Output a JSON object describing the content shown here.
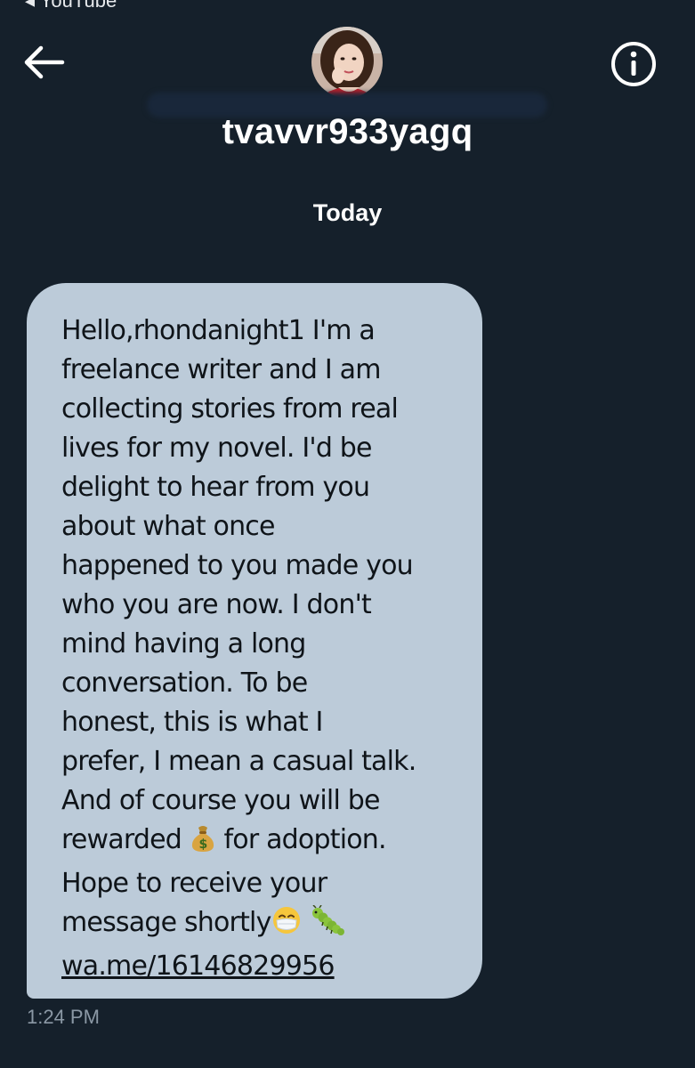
{
  "status_bar": {
    "back_app_label": "◂ YouTube"
  },
  "header": {
    "username": "tvavvr933yagq",
    "back_icon": "arrow-left-icon",
    "info_icon": "info-icon"
  },
  "conversation": {
    "date_separator": "Today",
    "message": {
      "lines": [
        "Hello,rhondanight1 I'm a",
        "freelance writer and I am",
        "collecting stories from real",
        "lives for my novel. I'd be",
        "delight to hear from you",
        "about what once",
        "happened to you made you",
        "who you are now. I don't",
        "mind having a long",
        "conversation. To be",
        "honest, this is what I",
        "prefer, I mean a casual talk.",
        "And of course you will be"
      ],
      "line_reward_before": "rewarded",
      "line_reward_after": "for adoption.",
      "line_hope": "Hope to receive your",
      "line_shortly": "message shortly",
      "link": "wa.me/16146829956",
      "emojis": [
        "money-bag-icon",
        "mask-face-icon",
        "caterpillar-icon"
      ],
      "time": "1:24 PM"
    }
  },
  "colors": {
    "background": "#15202b",
    "bubble": "#bccbd9",
    "bubble_text": "#0f1419",
    "timestamp": "#8b98a5"
  }
}
